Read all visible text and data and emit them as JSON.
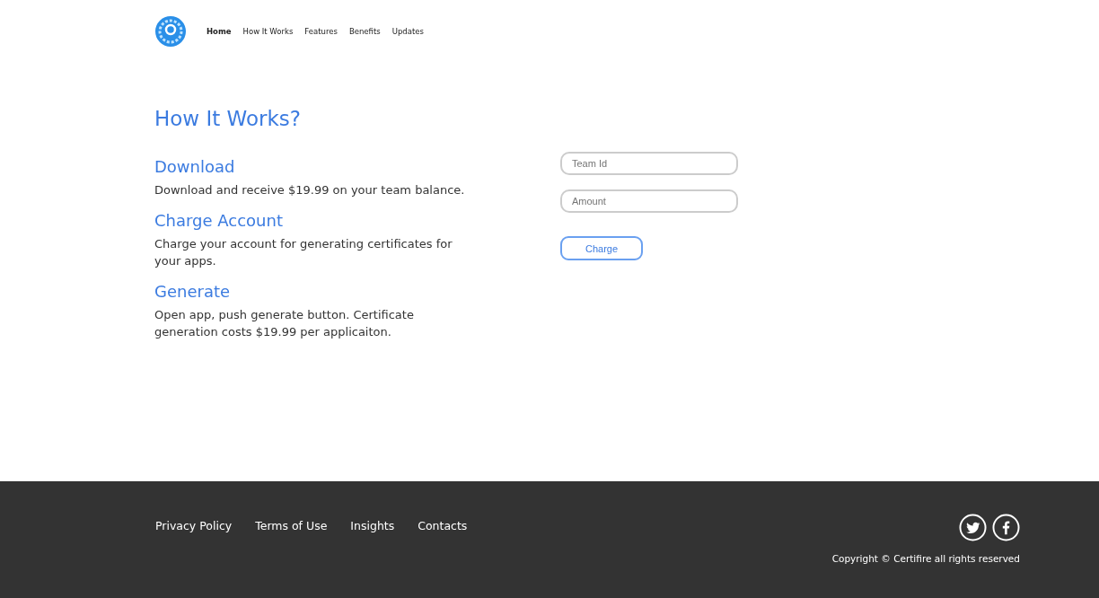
{
  "nav": {
    "items": [
      {
        "label": "Home",
        "selected": true
      },
      {
        "label": "How It Works",
        "selected": false
      },
      {
        "label": "Features",
        "selected": false
      },
      {
        "label": "Benefits",
        "selected": false
      },
      {
        "label": "Updates",
        "selected": false
      }
    ]
  },
  "section": {
    "title": "How It Works?",
    "steps": [
      {
        "title": "Download",
        "text": "Download and receive $19.99 on your team balance."
      },
      {
        "title": "Charge Account",
        "text": "Charge your account for generating certificates for your apps."
      },
      {
        "title": "Generate",
        "text": "Open app, push generate button. Certificate generation costs $19.99 per applicaiton."
      }
    ]
  },
  "form": {
    "fields": [
      {
        "placeholder": "Team Id"
      },
      {
        "placeholder": "Amount"
      }
    ],
    "button": "Charge"
  },
  "footer": {
    "links": [
      "Privacy Policy",
      "Terms of Use",
      "Insights",
      "Contacts"
    ],
    "copyright": "Copyright © Certifire all rights reserved"
  }
}
